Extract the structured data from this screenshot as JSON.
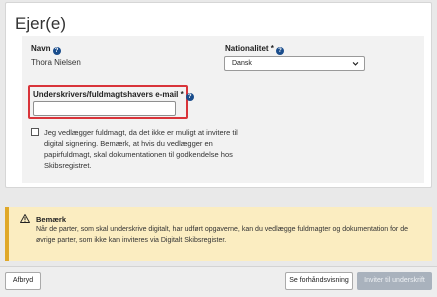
{
  "section": {
    "title": "Ejer(e)"
  },
  "owner": {
    "name_label": "Navn",
    "name_value": "Thora Nielsen",
    "nationality_label": "Nationalitet *",
    "nationality_value": "Dansk"
  },
  "email": {
    "label": "Underskrivers/fuldmagtshavers e-mail *",
    "value": ""
  },
  "power_of_attorney": {
    "checked": false,
    "text": "Jeg vedlægger fuldmagt, da det ikke er muligt at invitere til digital signering. Bemærk, at hvis du vedlægger en papirfuldmagt, skal dokumentationen til godkendelse hos Skibsregistret."
  },
  "notice": {
    "title": "Bemærk",
    "text": "Når de parter, som skal underskrive digitalt, har udført opgaverne, kan du vedlægge fuldmagter og dokumentation for de øvrige parter, som ikke kan inviteres via Digitalt Skibsregister."
  },
  "footer": {
    "cancel": "Afbryd",
    "preview": "Se forhåndsvisning",
    "invite": "Inviter til underskrift"
  },
  "colors": {
    "accent_help": "#1a4d8c",
    "highlight": "#d9343a",
    "notice_bg": "#fbedc1",
    "notice_border": "#e0a829"
  },
  "icons": [
    "help-icon",
    "chevron-down-icon",
    "warning-icon"
  ]
}
